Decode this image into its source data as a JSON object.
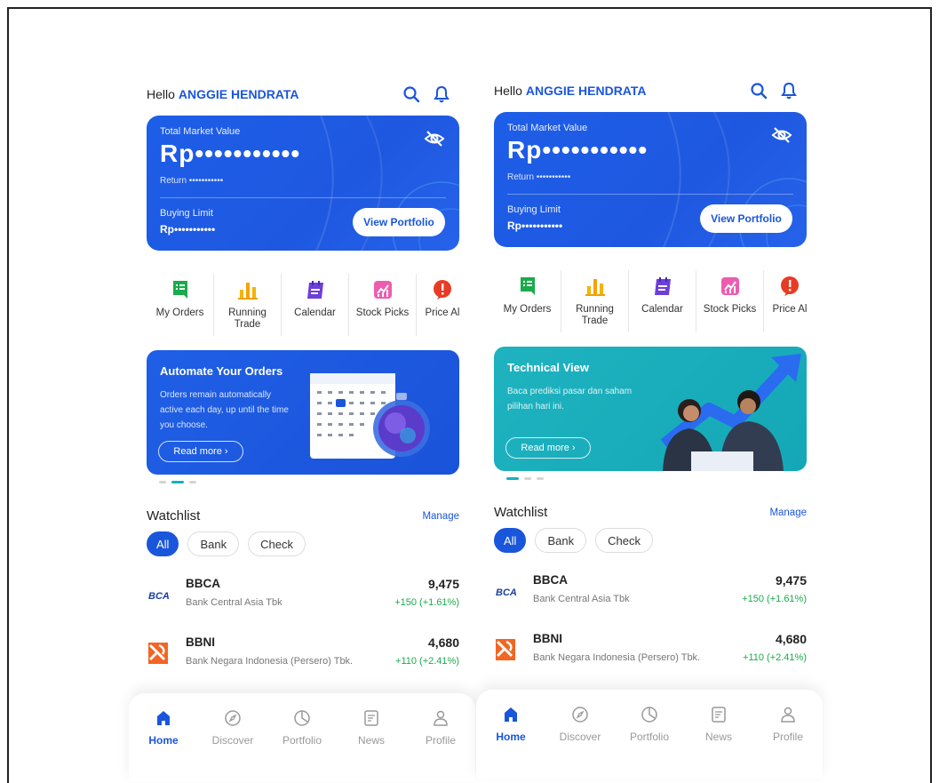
{
  "colors": {
    "primary": "#1a56db",
    "positive": "#1bab4c",
    "teal": "#14b0bf"
  },
  "phones": [
    {
      "greeting": "Hello",
      "user_name": "ANGGIE HENDRATA",
      "card": {
        "total_label": "Total Market Value",
        "total_value": "Rp•••••••••••",
        "return_label": "Return •••••••••••",
        "buying_limit_label": "Buying Limit",
        "buying_limit_value": "Rp•••••••••••",
        "view_portfolio": "View Portfolio"
      },
      "menu": [
        {
          "label": "My Orders",
          "icon": "orders-icon"
        },
        {
          "label": "Running Trade",
          "icon": "bar-chart-icon"
        },
        {
          "label": "Calendar",
          "icon": "calendar-icon"
        },
        {
          "label": "Stock Picks",
          "icon": "stock-picks-icon"
        },
        {
          "label": "Price Al",
          "icon": "price-alert-icon"
        }
      ],
      "banner": {
        "title": "Automate Your Orders",
        "desc": "Orders remain automatically active each day, up until the time you choose.",
        "cta": "Read more  ›"
      },
      "watchlist": {
        "title": "Watchlist",
        "manage": "Manage",
        "chips": [
          "All",
          "Bank",
          "Check"
        ],
        "rows": [
          {
            "ticker": "BBCA",
            "name": "Bank Central Asia Tbk",
            "price": "9,475",
            "change": "+150 (+1.61%)",
            "logo": "BCA"
          },
          {
            "ticker": "BBNI",
            "name": "Bank Negara Indonesia (Persero) Tbk.",
            "price": "4,680",
            "change": "+110 (+2.41%)",
            "logo": "BNI"
          }
        ]
      },
      "nav": [
        {
          "label": "Home",
          "icon": "home-icon",
          "active": true
        },
        {
          "label": "Discover",
          "icon": "compass-icon"
        },
        {
          "label": "Portfolio",
          "icon": "pie-chart-icon"
        },
        {
          "label": "News",
          "icon": "news-icon"
        },
        {
          "label": "Profile",
          "icon": "user-icon"
        }
      ]
    },
    {
      "greeting": "Hello",
      "user_name": "ANGGIE HENDRATA",
      "card": {
        "total_label": "Total Market Value",
        "total_value": "Rp•••••••••••",
        "return_label": "Return •••••••••••",
        "buying_limit_label": "Buying Limit",
        "buying_limit_value": "Rp•••••••••••",
        "view_portfolio": "View Portfolio"
      },
      "menu": [
        {
          "label": "My Orders",
          "icon": "orders-icon"
        },
        {
          "label": "Running Trade",
          "icon": "bar-chart-icon"
        },
        {
          "label": "Calendar",
          "icon": "calendar-icon"
        },
        {
          "label": "Stock Picks",
          "icon": "stock-picks-icon"
        },
        {
          "label": "Price Al",
          "icon": "price-alert-icon"
        }
      ],
      "banner": {
        "title": "Technical View",
        "desc": "Baca prediksi pasar dan saham pilihan hari ini.",
        "cta": "Read more  ›"
      },
      "watchlist": {
        "title": "Watchlist",
        "manage": "Manage",
        "chips": [
          "All",
          "Bank",
          "Check"
        ],
        "rows": [
          {
            "ticker": "BBCA",
            "name": "Bank Central Asia Tbk",
            "price": "9,475",
            "change": "+150 (+1.61%)",
            "logo": "BCA"
          },
          {
            "ticker": "BBNI",
            "name": "Bank Negara Indonesia (Persero) Tbk.",
            "price": "4,680",
            "change": "+110 (+2.41%)",
            "logo": "BNI"
          }
        ]
      },
      "nav": [
        {
          "label": "Home",
          "icon": "home-icon",
          "active": true
        },
        {
          "label": "Discover",
          "icon": "compass-icon"
        },
        {
          "label": "Portfolio",
          "icon": "pie-chart-icon"
        },
        {
          "label": "News",
          "icon": "news-icon"
        },
        {
          "label": "Profile",
          "icon": "user-icon"
        }
      ]
    }
  ]
}
